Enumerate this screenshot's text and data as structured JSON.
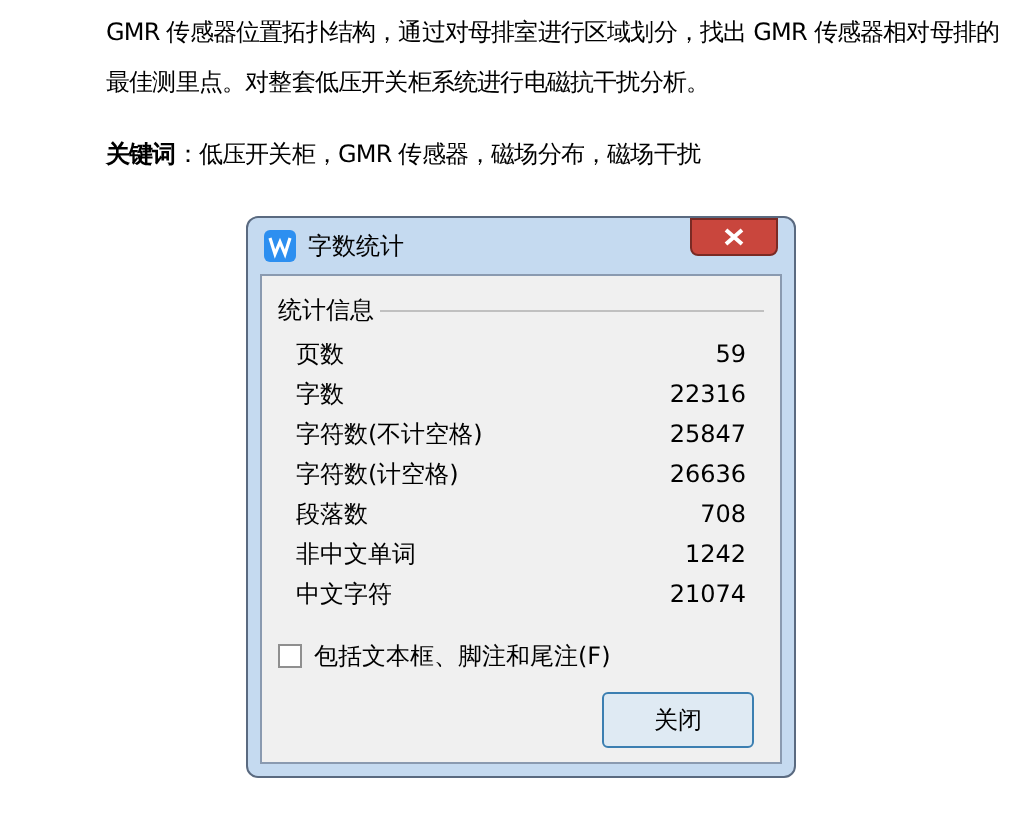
{
  "document": {
    "lines": [
      "GMR 传感器位置拓扑结构，通过对母排室进行区域划分，找出 GMR 传感器相对母排的",
      "最佳测里点。对整套低压开关柜系统进行电磁抗干扰分析。"
    ],
    "keywords": "**关键词**：低压开关柜，GMR 传感器，磁场分布，磁场干扰"
  },
  "dialog": {
    "title": "字数统计",
    "group": "统计信息",
    "stats": [
      {
        "label": "页数",
        "value": "59"
      },
      {
        "label": "字数",
        "value": "22316"
      },
      {
        "label": "字符数(不计空格)",
        "value": "25847"
      },
      {
        "label": "字符数(计空格)",
        "value": "26636"
      },
      {
        "label": "段落数",
        "value": "708"
      },
      {
        "label": "非中文单词",
        "value": "1242"
      },
      {
        "label": "中文字符",
        "value": "21074"
      }
    ],
    "checkbox": {
      "label": "包括文本框、脚注和尾注(F)",
      "checked": false
    },
    "button": "关闭"
  }
}
